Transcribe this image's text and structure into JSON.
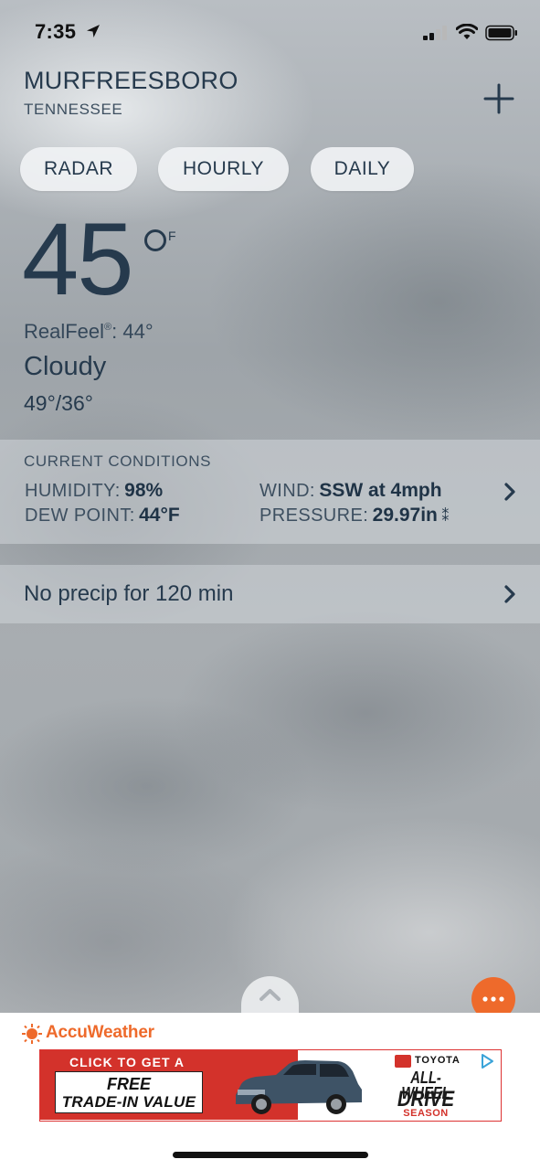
{
  "status_bar": {
    "time": "7:35"
  },
  "header": {
    "city": "MURFREESBORO",
    "state": "TENNESSEE"
  },
  "tabs": [
    {
      "label": "RADAR"
    },
    {
      "label": "HOURLY"
    },
    {
      "label": "DAILY"
    }
  ],
  "current": {
    "temperature": "45",
    "unit": "F",
    "realfeel_label": "RealFeel",
    "realfeel_mark": "®",
    "realfeel_value": ": 44°",
    "condition": "Cloudy",
    "hi_lo": "49°/36°"
  },
  "conditions_panel": {
    "title": "CURRENT CONDITIONS",
    "humidity_label": "HUMIDITY:",
    "humidity_value": "98%",
    "dew_point_label": "DEW POINT:",
    "dew_point_value": "44°F",
    "wind_label": "WIND:",
    "wind_value": "SSW at 4mph",
    "pressure_label": "PRESSURE:",
    "pressure_value": "29.97in",
    "pressure_trend_icon": "pressure-steady-icon"
  },
  "minutecast": {
    "text": "No precip for 120 min"
  },
  "brand": {
    "name": "AccuWeather",
    "color": "#ee6a2b"
  },
  "ad": {
    "cta": "CLICK TO GET A",
    "free": "FREE",
    "trade_in": "TRADE-IN VALUE",
    "brand": "TOYOTA",
    "awd": "ALL-WHEEL",
    "drive": "DRIVE",
    "season": "SEASON",
    "accent_color": "#d3322b"
  },
  "icons": {
    "more": "more-icon",
    "add": "plus-icon",
    "expand": "chevron-up-icon"
  }
}
